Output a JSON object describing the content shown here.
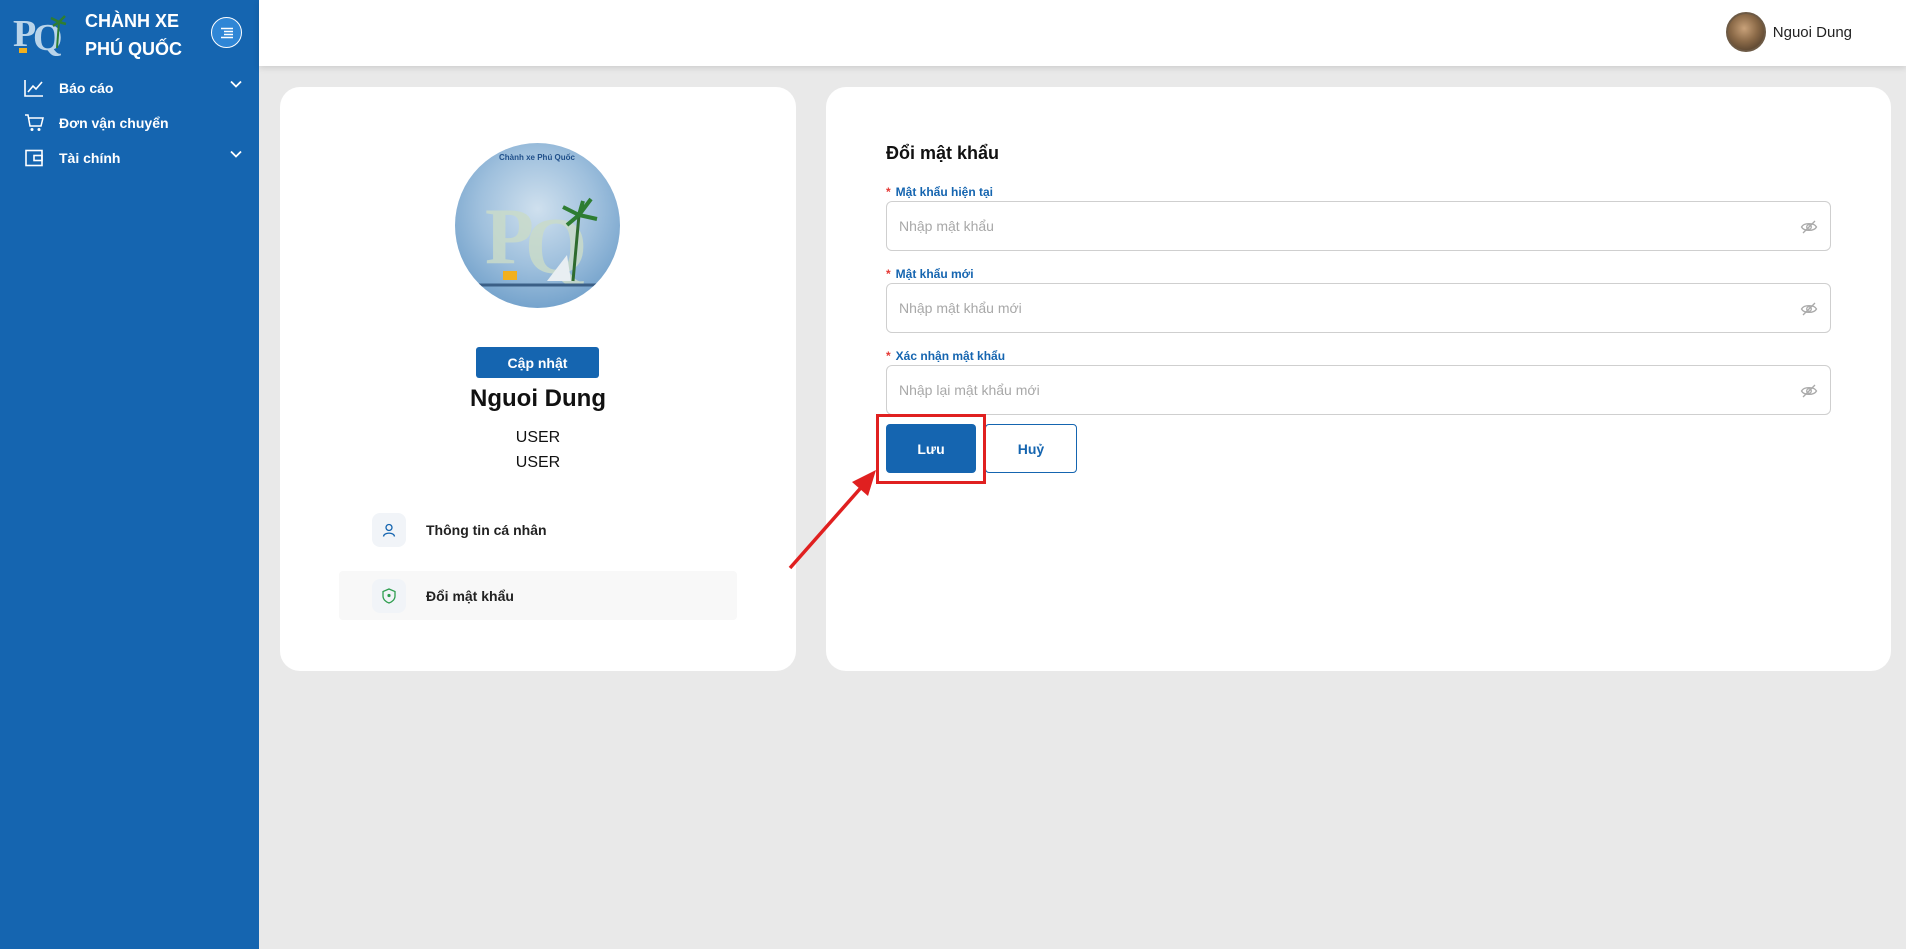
{
  "brand": {
    "line1": "CHÀNH XE",
    "line2": "PHÚ QUỐC",
    "logo_text": "PQ",
    "logo_icon": "pq-logo-icon"
  },
  "sidebar": {
    "toggle_icon": "menu-fold-icon",
    "items": [
      {
        "label": "Báo cáo",
        "icon": "line-chart-icon",
        "expandable": true
      },
      {
        "label": "Đơn vận chuyển",
        "icon": "shopping-cart-icon",
        "expandable": false
      },
      {
        "label": "Tài chính",
        "icon": "wallet-icon",
        "expandable": true
      }
    ]
  },
  "header": {
    "user_name": "Nguoi Dung",
    "avatar_icon": "user-avatar"
  },
  "profile": {
    "logo_caption": "Chành xe Phú Quốc",
    "logo_letters": "PQ",
    "update_label": "Cập nhật",
    "name": "Nguoi Dung",
    "role_1": "USER",
    "role_2": "USER",
    "menu": [
      {
        "label": "Thông tin cá nhân",
        "icon": "user-icon",
        "active": false
      },
      {
        "label": "Đổi mật khẩu",
        "icon": "shield-icon",
        "active": true
      }
    ]
  },
  "change_password": {
    "title": "Đổi mật khẩu",
    "required_mark": "*",
    "current": {
      "label": "Mật khẩu hiện tại",
      "placeholder": "Nhập mật khẩu",
      "value": ""
    },
    "new": {
      "label": "Mật khẩu mới",
      "placeholder": "Nhập mật khẩu mới",
      "value": ""
    },
    "confirm": {
      "label": "Xác nhận mật khẩu",
      "placeholder": "Nhập lại mật khẩu mới",
      "value": ""
    },
    "save_label": "Lưu",
    "cancel_label": "Huỷ"
  },
  "colors": {
    "primary": "#1565b0",
    "required": "#e53935",
    "annotation": "#e02020",
    "background": "#e9e9e9"
  }
}
